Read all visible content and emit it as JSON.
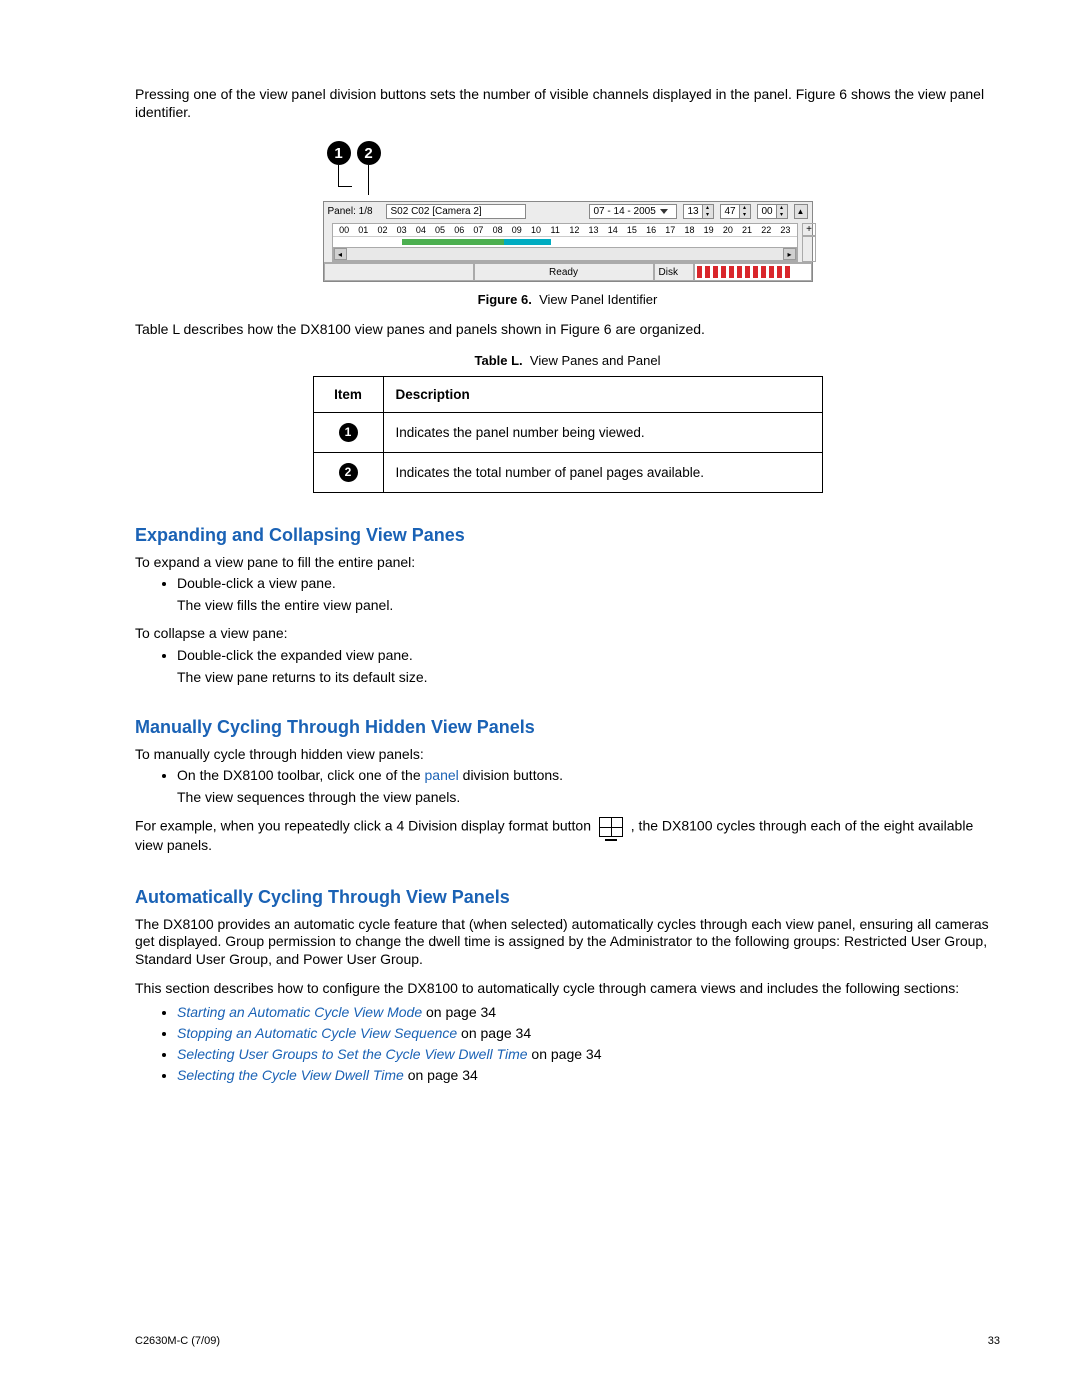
{
  "intro_p1": "Pressing one of the view panel division buttons sets the number of visible channels displayed in the panel. Figure 6 shows the view panel identifier.",
  "figure": {
    "callout1": "1",
    "callout2": "2",
    "panel_label": "Panel: 1/8",
    "site_field": "S02 C02 [Camera 2]",
    "date_field": "07 - 14 - 2005",
    "time_h": "13",
    "time_m": "47",
    "time_s": "00",
    "timeline_hours": [
      "00",
      "01",
      "02",
      "03",
      "04",
      "05",
      "06",
      "07",
      "08",
      "09",
      "10",
      "11",
      "12",
      "13",
      "14",
      "15",
      "16",
      "17",
      "18",
      "19",
      "20",
      "21",
      "22",
      "23"
    ],
    "plus": "+",
    "status_ready": "Ready",
    "status_disk": "Disk",
    "caption_label": "Figure 6.",
    "caption_text": "View Panel Identifier"
  },
  "after_figure": "Table L describes how the DX8100 view panes and panels shown in Figure 6 are organized.",
  "table": {
    "caption_label": "Table L.",
    "caption_text": "View Panes and Panel",
    "h_item": "Item",
    "h_desc": "Description",
    "rows": [
      {
        "num": "1",
        "desc": "Indicates the panel number being viewed."
      },
      {
        "num": "2",
        "desc": "Indicates the total number of panel pages available."
      }
    ]
  },
  "sec1": {
    "title": "Expanding and Collapsing View Panes",
    "p1": "To expand a view pane to fill the entire panel:",
    "b1": "Double-click a view pane.",
    "b1_sub": "The view fills the entire view panel.",
    "p2": "To collapse a view pane:",
    "b2": "Double-click the expanded view pane.",
    "b2_sub": "The view pane returns to its default size."
  },
  "sec2": {
    "title": "Manually Cycling Through Hidden View Panels",
    "p1": "To manually cycle through hidden view panels:",
    "b1_a": "On the DX8100 toolbar, click one of the ",
    "b1_link": "panel",
    "b1_b": " division buttons.",
    "b1_sub": "The view sequences through the view panels.",
    "p2_a": "For example, when you repeatedly click a 4 Division display format button ",
    "p2_b": " , the DX8100 cycles through each of the eight available view panels."
  },
  "sec3": {
    "title": "Automatically Cycling Through View Panels",
    "p1": "The DX8100 provides an automatic cycle feature that (when selected) automatically cycles through each view panel, ensuring all cameras get displayed. Group permission to change the dwell time is assigned by the Administrator to the following groups: Restricted User Group, Standard User Group, and Power User Group.",
    "p2": "This section describes how to configure the DX8100 to automatically cycle through camera views and includes the following sections:",
    "refs": [
      {
        "text": "Starting an Automatic Cycle View Mode",
        "suffix": " on page 34"
      },
      {
        "text": "Stopping an Automatic Cycle View Sequence",
        "suffix": " on page 34"
      },
      {
        "text": "Selecting User Groups to Set the Cycle View Dwell Time",
        "suffix": " on page 34"
      },
      {
        "text": "Selecting the Cycle View Dwell Time",
        "suffix": " on page 34"
      }
    ]
  },
  "footer": {
    "left": "C2630M-C (7/09)",
    "right": "33"
  }
}
